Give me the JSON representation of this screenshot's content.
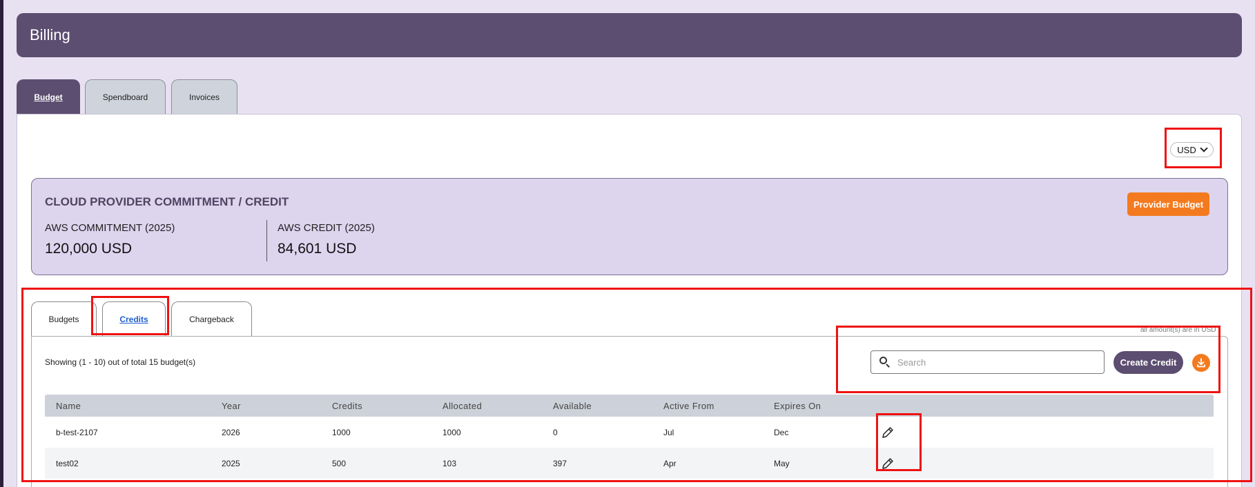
{
  "header": {
    "title": "Billing"
  },
  "top_tabs": [
    {
      "label": "Budget",
      "active": true
    },
    {
      "label": "Spendboard",
      "active": false
    },
    {
      "label": "Invoices",
      "active": false
    }
  ],
  "currency": {
    "selected": "USD"
  },
  "commitment_card": {
    "title": "CLOUD PROVIDER COMMITMENT / CREDIT",
    "provider_button": "Provider Budget",
    "metrics": [
      {
        "label": "AWS COMMITMENT (2025)",
        "value": "120,000  USD"
      },
      {
        "label": "AWS CREDIT (2025)",
        "value": "84,601  USD"
      }
    ]
  },
  "sub_tabs": [
    {
      "label": "Budgets",
      "active": false
    },
    {
      "label": "Credits",
      "active": true
    },
    {
      "label": "Chargeback",
      "active": false
    }
  ],
  "amount_note": "all amount(s) are in USD",
  "showing_text": "Showing  (1 - 10) out of total 15 budget(s)",
  "search": {
    "placeholder": "Search",
    "value": ""
  },
  "create_button": "Create Credit",
  "table": {
    "headers": [
      "Name",
      "Year",
      "Credits",
      "Allocated",
      "Available",
      "Active From",
      "Expires On"
    ],
    "rows": [
      [
        "b-test-2107",
        "2026",
        "1000",
        "1000",
        "0",
        "Jul",
        "Dec"
      ],
      [
        "test02",
        "2025",
        "500",
        "103",
        "397",
        "Apr",
        "May"
      ]
    ]
  },
  "colors": {
    "brand_purple": "#5c4e70",
    "accent_orange": "#f47a1f",
    "highlight_red": "#ee1111",
    "card_bg": "#ddd4ee"
  },
  "icons": [
    "chevron-down-icon",
    "search-icon",
    "download-icon",
    "pencil-icon"
  ]
}
